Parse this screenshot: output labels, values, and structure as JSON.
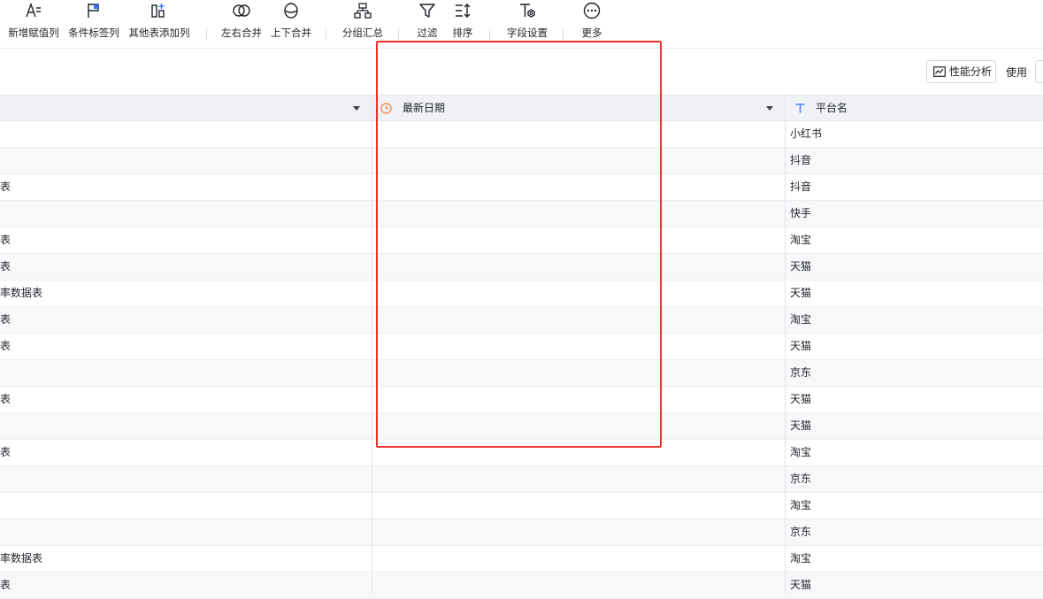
{
  "toolbar": {
    "buttons": [
      {
        "label": "新增赋值列",
        "icon": "add-assign-column-icon"
      },
      {
        "label": "条件标签列",
        "icon": "condition-tag-icon"
      },
      {
        "label": "其他表添加列",
        "icon": "add-column-from-table-icon"
      },
      {
        "label": "左右合并",
        "icon": "merge-horizontal-icon"
      },
      {
        "label": "上下合并",
        "icon": "merge-vertical-icon"
      },
      {
        "label": "分组汇总",
        "icon": "group-summary-icon"
      },
      {
        "label": "过滤",
        "icon": "filter-icon"
      },
      {
        "label": "排序",
        "icon": "sort-icon"
      },
      {
        "label": "字段设置",
        "icon": "field-settings-icon"
      },
      {
        "label": "更多",
        "icon": "more-icon"
      }
    ]
  },
  "subbar": {
    "perf_label": "性能分析",
    "use_label": "使用"
  },
  "grid": {
    "columns": [
      {
        "label": "",
        "type_icon": ""
      },
      {
        "label": "最新日期",
        "type_icon": "clock-icon"
      },
      {
        "label": "平台名",
        "type_icon": "text-type-icon"
      }
    ],
    "rows": [
      {
        "c1": "",
        "c2": "",
        "c3": "小红书"
      },
      {
        "c1": "",
        "c2": "",
        "c3": "抖音"
      },
      {
        "c1": "表",
        "c2": "",
        "c3": "抖音"
      },
      {
        "c1": "",
        "c2": "",
        "c3": "快手"
      },
      {
        "c1": "表",
        "c2": "",
        "c3": "淘宝"
      },
      {
        "c1": "表",
        "c2": "",
        "c3": "天猫"
      },
      {
        "c1": "率数据表",
        "c2": "",
        "c3": "天猫"
      },
      {
        "c1": "表",
        "c2": "",
        "c3": "淘宝"
      },
      {
        "c1": "表",
        "c2": "",
        "c3": "天猫"
      },
      {
        "c1": "",
        "c2": "",
        "c3": "京东"
      },
      {
        "c1": "表",
        "c2": "",
        "c3": "天猫"
      },
      {
        "c1": "",
        "c2": "",
        "c3": "天猫"
      },
      {
        "c1": "表",
        "c2": "",
        "c3": "淘宝"
      },
      {
        "c1": "",
        "c2": "",
        "c3": "京东"
      },
      {
        "c1": "",
        "c2": "",
        "c3": "淘宝"
      },
      {
        "c1": "",
        "c2": "",
        "c3": "京东"
      },
      {
        "c1": "率数据表",
        "c2": "",
        "c3": "淘宝"
      },
      {
        "c1": "表",
        "c2": "",
        "c3": "天猫"
      }
    ]
  },
  "colors": {
    "accent": "#3370ff",
    "date_icon": "#f5843a",
    "highlight_border": "#e8312a",
    "header_bg": "#f0f2f5"
  }
}
